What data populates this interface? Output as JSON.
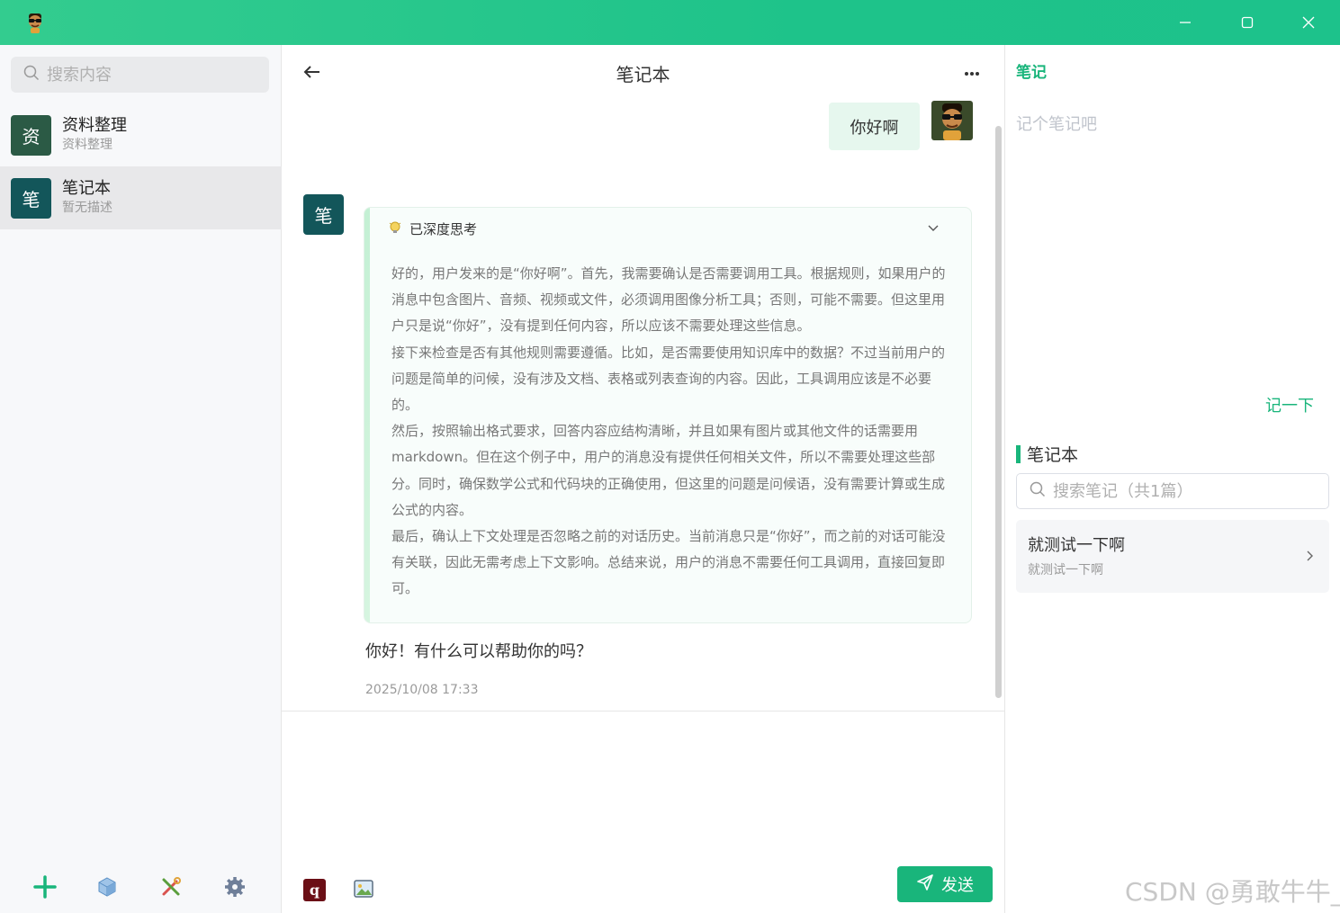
{
  "window": {
    "controls": {
      "minimize_icon": "minimize-icon",
      "maximize_icon": "maximize-icon",
      "close_icon": "close-icon"
    }
  },
  "sidebar": {
    "search_placeholder": "搜索内容",
    "items": [
      {
        "avatar_char": "资",
        "title": "资料整理",
        "subtitle": "资料整理",
        "avatar_color": "#2b5a45"
      },
      {
        "avatar_char": "笔",
        "title": "笔记本",
        "subtitle": "暂无描述",
        "avatar_color": "#13565a"
      }
    ],
    "bottom_icons": [
      "add-icon",
      "cube-icon",
      "tools-icon",
      "gear-icon"
    ]
  },
  "chat": {
    "title": "笔记本",
    "user_message": "你好啊",
    "bot_avatar_char": "笔",
    "thinking": {
      "label": "已深度思考",
      "paragraphs": [
        "好的，用户发来的是“你好啊”。首先，我需要确认是否需要调用工具。根据规则，如果用户的消息中包含图片、音频、视频或文件，必须调用图像分析工具；否则，可能不需要。但这里用户只是说“你好”，没有提到任何内容，所以应该不需要处理这些信息。",
        "接下来检查是否有其他规则需要遵循。比如，是否需要使用知识库中的数据？不过当前用户的问题是简单的问候，没有涉及文档、表格或列表查询的内容。因此，工具调用应该是不必要的。",
        "然后，按照输出格式要求，回答内容应结构清晰，并且如果有图片或其他文件的话需要用markdown。但在这个例子中，用户的消息没有提供任何相关文件，所以不需要处理这些部分。同时，确保数学公式和代码块的正确使用，但这里的问题是问候语，没有需要计算或生成公式的内容。",
        "最后，确认上下文处理是否忽略之前的对话历史。当前消息只是“你好”，而之前的对话可能没有关联，因此无需考虑上下文影响。总结来说，用户的消息不需要任何工具调用，直接回复即可。"
      ]
    },
    "reply": "你好！有什么可以帮助你的吗？",
    "timestamp": "2025/10/08 17:33",
    "composer": {
      "tool_q_label": "q",
      "send_label": "发送"
    }
  },
  "notes": {
    "title": "笔记",
    "input_placeholder": "记个笔记吧",
    "submit_label": "记一下",
    "notebook_heading": "笔记本",
    "search_placeholder": "搜索笔记（共1篇）",
    "cards": [
      {
        "title": "就测试一下啊",
        "subtitle": "就测试一下啊"
      }
    ]
  },
  "watermark": "CSDN @勇敢牛牛_",
  "colors": {
    "accent": "#19b57b",
    "titlebar": "#1ec38a"
  }
}
